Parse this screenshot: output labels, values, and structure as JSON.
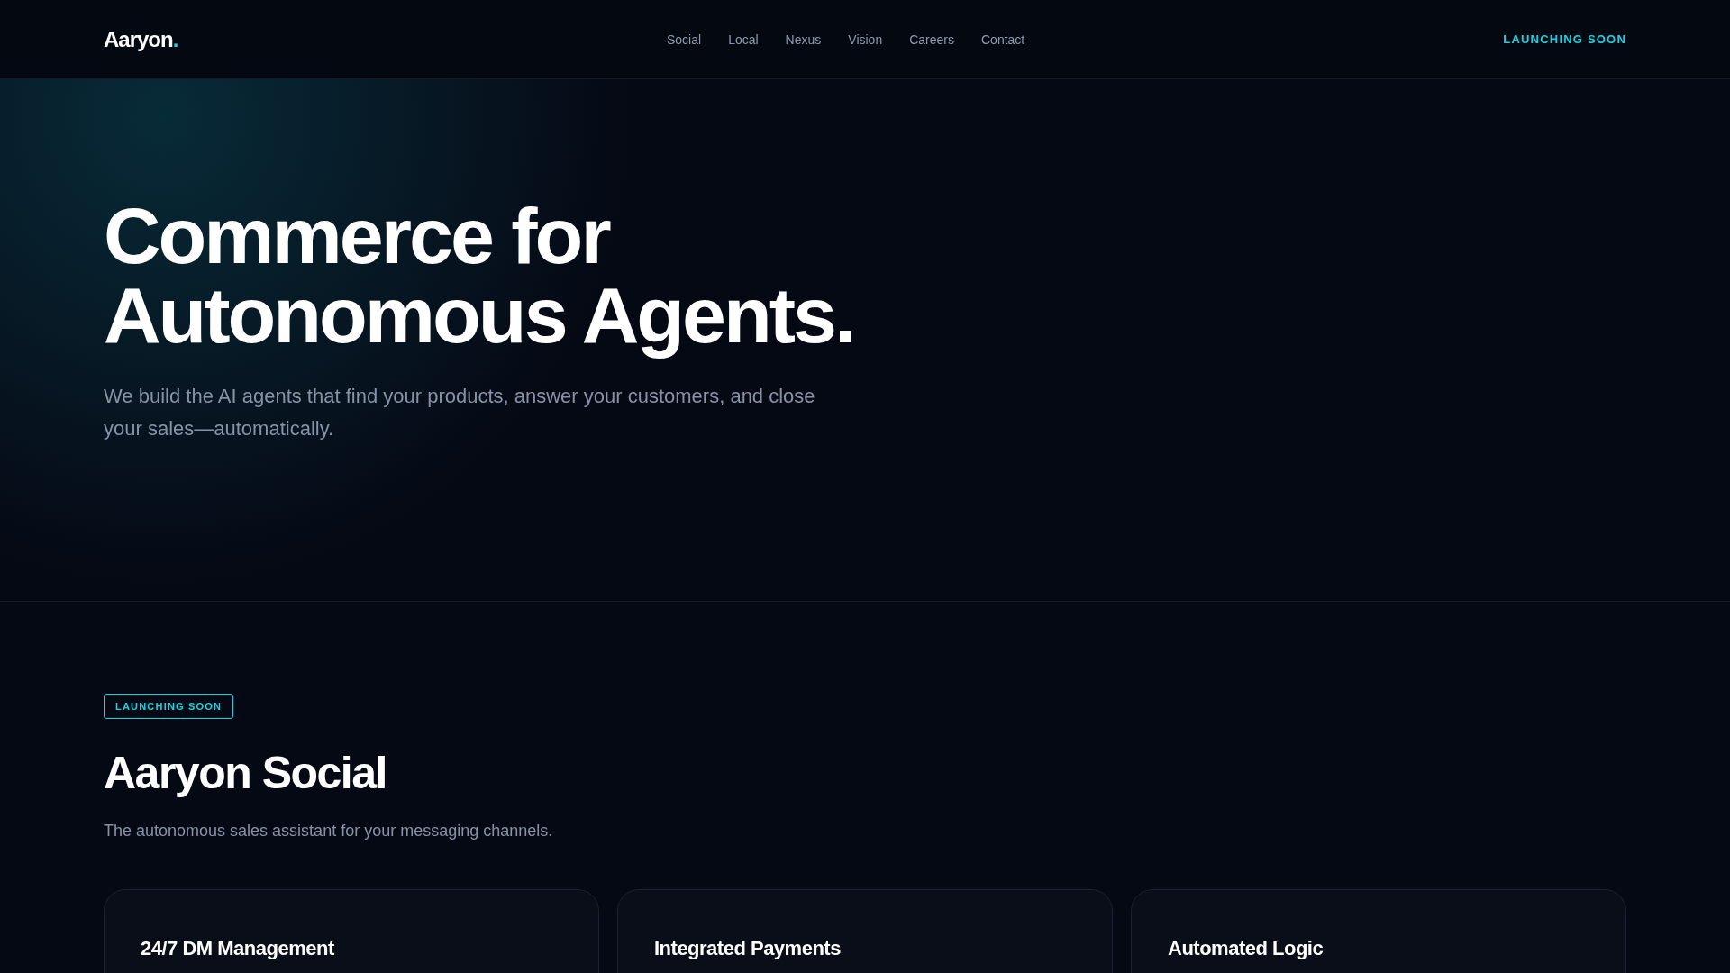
{
  "header": {
    "logo": {
      "name": "Aaryon",
      "dot": "."
    },
    "nav": [
      {
        "label": "Social"
      },
      {
        "label": "Local"
      },
      {
        "label": "Nexus"
      },
      {
        "label": "Vision"
      },
      {
        "label": "Careers"
      },
      {
        "label": "Contact"
      }
    ],
    "cta": "LAUNCHING SOON"
  },
  "hero": {
    "title_lines": [
      "Commerce for",
      "Autonomous Agents."
    ],
    "subtitle": "We build the AI agents that find your products, answer your customers, and close your sales—automatically."
  },
  "product": {
    "badge": "LAUNCHING SOON",
    "title": "Aaryon Social",
    "description": "The autonomous sales assistant for your messaging channels.",
    "features": [
      {
        "title": "24/7 DM Management"
      },
      {
        "title": "Integrated Payments"
      },
      {
        "title": "Automated Logic"
      }
    ]
  }
}
